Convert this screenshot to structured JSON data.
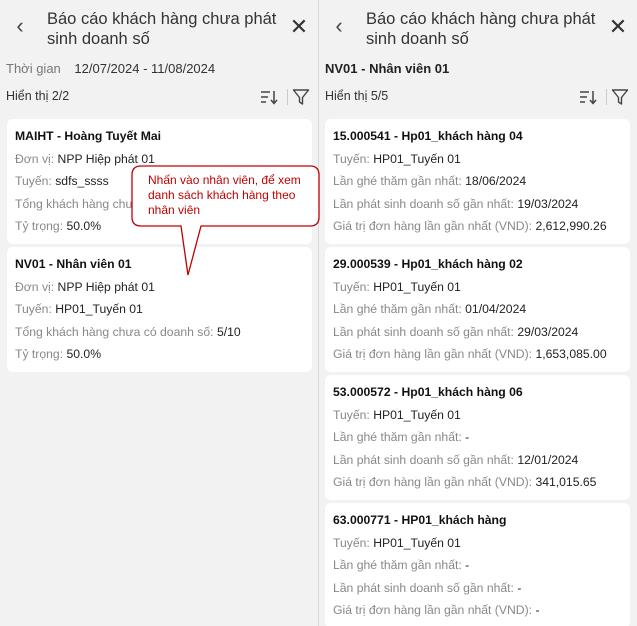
{
  "left": {
    "title": "Báo cáo khách hàng chưa phát sinh doanh số",
    "period_label": "Thời gian",
    "period_value": "12/07/2024 - 11/08/2024",
    "count": "Hiển thị 2/2",
    "cards": [
      {
        "name": "MAIHT - Hoàng Tuyết Mai",
        "unit_label": "Đơn vị:",
        "unit_value": "NPP Hiệp phát 01",
        "route_label": "Tuyến:",
        "route_value": "sdfs_ssss",
        "total_label": "Tổng khách hàng chưa có doanh số:",
        "total_value": "",
        "ratio_label": "Tỷ trọng:",
        "ratio_value": "50.0%"
      },
      {
        "name": "NV01 - Nhân viên 01",
        "unit_label": "Đơn vị:",
        "unit_value": "NPP Hiệp phát 01",
        "route_label": "Tuyến:",
        "route_value": "HP01_Tuyến 01",
        "total_label": "Tổng khách hàng chưa có doanh số:",
        "total_value": "5/10",
        "ratio_label": "Tỷ trọng:",
        "ratio_value": "50.0%"
      }
    ],
    "callout": "Nhấn vào nhân viên, để xem danh sách khách hàng theo nhân viên"
  },
  "right": {
    "title": "Báo cáo khách hàng chưa phát sinh doanh số",
    "employee": "NV01 - Nhân viên 01",
    "count": "Hiển thị 5/5",
    "cards": [
      {
        "name": "15.000541 - Hp01_khách hàng 04",
        "route_label": "Tuyến:",
        "route_value": "HP01_Tuyến 01",
        "visit_label": "Lần ghé thăm gần nhất:",
        "visit_value": "18/06/2024",
        "sale_label": "Lần phát sinh doanh số gần nhất:",
        "sale_value": "19/03/2024",
        "order_label": "Giá trị đơn hàng lần gần nhất (VND):",
        "order_value": "2,612,990.26"
      },
      {
        "name": "29.000539 - Hp01_khách hàng 02",
        "route_label": "Tuyến:",
        "route_value": "HP01_Tuyến 01",
        "visit_label": "Lần ghé thăm gần nhất:",
        "visit_value": "01/04/2024",
        "sale_label": "Lần phát sinh doanh số gần nhất:",
        "sale_value": "29/03/2024",
        "order_label": "Giá trị đơn hàng lần gần nhất (VND):",
        "order_value": "1,653,085.00"
      },
      {
        "name": "53.000572 - Hp01_khách hàng 06",
        "route_label": "Tuyến:",
        "route_value": "HP01_Tuyến 01",
        "visit_label": "Lần ghé thăm gần nhất:",
        "visit_value": "-",
        "sale_label": "Lần phát sinh doanh số gần nhất:",
        "sale_value": "12/01/2024",
        "order_label": "Giá trị đơn hàng lần gần nhất (VND):",
        "order_value": "341,015.65"
      },
      {
        "name": "63.000771 - HP01_khách hàng",
        "route_label": "Tuyến:",
        "route_value": "HP01_Tuyến 01",
        "visit_label": "Lần ghé thăm gần nhất:",
        "visit_value": "-",
        "sale_label": "Lần phát sinh doanh số gần nhất:",
        "sale_value": "-",
        "order_label": "Giá trị đơn hàng lần gần nhất (VND):",
        "order_value": "-"
      }
    ]
  },
  "icons": {
    "back": "chevron-left-icon",
    "close": "close-icon",
    "sort": "sort-icon",
    "filter": "filter-icon"
  },
  "colors": {
    "background": "#f2f2f2",
    "card": "#ffffff",
    "callout_text": "#c00000",
    "callout_border": "#c00000"
  }
}
